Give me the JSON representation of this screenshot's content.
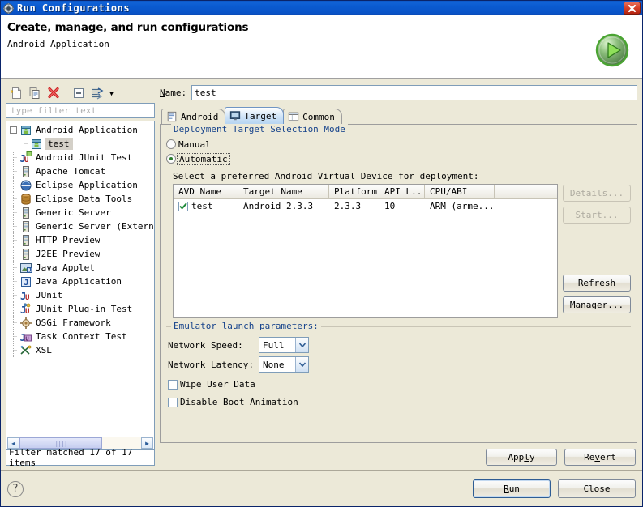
{
  "window": {
    "title": "Run Configurations",
    "title_icon": "run-config-gear-icon",
    "close_label": "✕"
  },
  "header": {
    "title": "Create, manage, and run configurations",
    "subtitle": "Android Application",
    "icon": "green-run-play-icon"
  },
  "left_toolbar": {
    "buttons": [
      {
        "name": "new-launch-configuration",
        "icon": "new-document-icon"
      },
      {
        "name": "duplicate-launch-configuration",
        "icon": "copy-icon"
      },
      {
        "name": "delete-launch-configuration",
        "icon": "red-x-delete-icon"
      },
      {
        "name": "collapse-all",
        "icon": "collapse-all-icon"
      },
      {
        "name": "filter-launch-configurations",
        "icon": "filter-icon"
      }
    ],
    "dropdown_arrow": "▾"
  },
  "filter": {
    "placeholder": "type filter text",
    "value": "",
    "status": "Filter matched 17 of 17 items"
  },
  "tree": {
    "items": [
      {
        "label": "Android Application",
        "icon": "android-app-icon",
        "level": 0,
        "expanded": true,
        "selected": false
      },
      {
        "label": "test",
        "icon": "android-app-icon",
        "level": 1,
        "expanded": null,
        "selected": true
      },
      {
        "label": "Android JUnit Test",
        "icon": "android-junit-icon",
        "level": 0,
        "expanded": null,
        "selected": false
      },
      {
        "label": "Apache Tomcat",
        "icon": "server-icon",
        "level": 0,
        "expanded": null,
        "selected": false
      },
      {
        "label": "Eclipse Application",
        "icon": "eclipse-icon",
        "level": 0,
        "expanded": null,
        "selected": false
      },
      {
        "label": "Eclipse Data Tools",
        "icon": "database-icon",
        "level": 0,
        "expanded": null,
        "selected": false
      },
      {
        "label": "Generic Server",
        "icon": "server-icon",
        "level": 0,
        "expanded": null,
        "selected": false
      },
      {
        "label": "Generic Server (External",
        "icon": "server-icon",
        "level": 0,
        "expanded": null,
        "selected": false
      },
      {
        "label": "HTTP Preview",
        "icon": "server-icon",
        "level": 0,
        "expanded": null,
        "selected": false
      },
      {
        "label": "J2EE Preview",
        "icon": "server-icon",
        "level": 0,
        "expanded": null,
        "selected": false
      },
      {
        "label": "Java Applet",
        "icon": "java-applet-icon",
        "level": 0,
        "expanded": null,
        "selected": false
      },
      {
        "label": "Java Application",
        "icon": "java-app-icon",
        "level": 0,
        "expanded": null,
        "selected": false
      },
      {
        "label": "JUnit",
        "icon": "junit-icon",
        "level": 0,
        "expanded": null,
        "selected": false
      },
      {
        "label": "JUnit Plug-in Test",
        "icon": "junit-plugin-icon",
        "level": 0,
        "expanded": null,
        "selected": false
      },
      {
        "label": "OSGi Framework",
        "icon": "osgi-icon",
        "level": 0,
        "expanded": null,
        "selected": false
      },
      {
        "label": "Task Context Test",
        "icon": "task-context-icon",
        "level": 0,
        "expanded": null,
        "selected": false
      },
      {
        "label": "XSL",
        "icon": "xsl-icon",
        "level": 0,
        "expanded": null,
        "selected": false
      }
    ]
  },
  "name_field": {
    "label_prefix": "",
    "label_mnemonic": "N",
    "label_rest": "ame:",
    "value": "test"
  },
  "tabs": [
    {
      "label": "Android",
      "icon": "android-tab-icon",
      "active": false
    },
    {
      "label": "Target",
      "icon": "target-monitor-icon",
      "active": true
    },
    {
      "label": "Common",
      "icon": "common-tab-icon",
      "active": false,
      "mnemonic": "C"
    }
  ],
  "target_tab": {
    "deployment_group_label": "Deployment Target Selection Mode",
    "radios": [
      {
        "label": "Manual",
        "selected": false
      },
      {
        "label": "Automatic",
        "selected": true
      }
    ],
    "hint": "Select a preferred Android Virtual Device for deployment:",
    "table": {
      "columns": [
        "AVD Name",
        "Target Name",
        "Platform",
        "API L...",
        "CPU/ABI"
      ],
      "rows": [
        {
          "checked": true,
          "avd_name": "test",
          "target_name": "Android 2.3.3",
          "platform": "2.3.3",
          "api_level": "10",
          "cpu_abi": "ARM (arme..."
        }
      ]
    },
    "side_buttons": [
      {
        "label": "Details...",
        "enabled": false
      },
      {
        "label": "Start...",
        "enabled": false
      },
      {
        "label": "Refresh",
        "enabled": true
      },
      {
        "label": "Manager...",
        "enabled": true
      }
    ],
    "emulator_group_label": "Emulator launch parameters:",
    "network_speed": {
      "label": "Network Speed:",
      "value": "Full"
    },
    "network_latency": {
      "label": "Network Latency:",
      "value": "None"
    },
    "checkboxes": [
      {
        "label": "Wipe User Data",
        "checked": false
      },
      {
        "label": "Disable Boot Animation",
        "checked": false
      }
    ]
  },
  "apply_row": [
    {
      "label": "Apply",
      "mnemonic": "y",
      "enabled": true
    },
    {
      "label": "Revert",
      "mnemonic": "v",
      "enabled": true
    }
  ],
  "footer": {
    "help_icon": "?",
    "buttons": [
      {
        "label": "Run",
        "mnemonic": "R",
        "default": true
      },
      {
        "label": "Close",
        "mnemonic": "",
        "default": false
      }
    ]
  },
  "colors": {
    "titlebar_blue": "#0a5ad0",
    "dialog_bg": "#ece9d8",
    "group_label_blue": "#15428b",
    "accent_green": "#2d7d2d",
    "delete_red": "#cc2222"
  }
}
